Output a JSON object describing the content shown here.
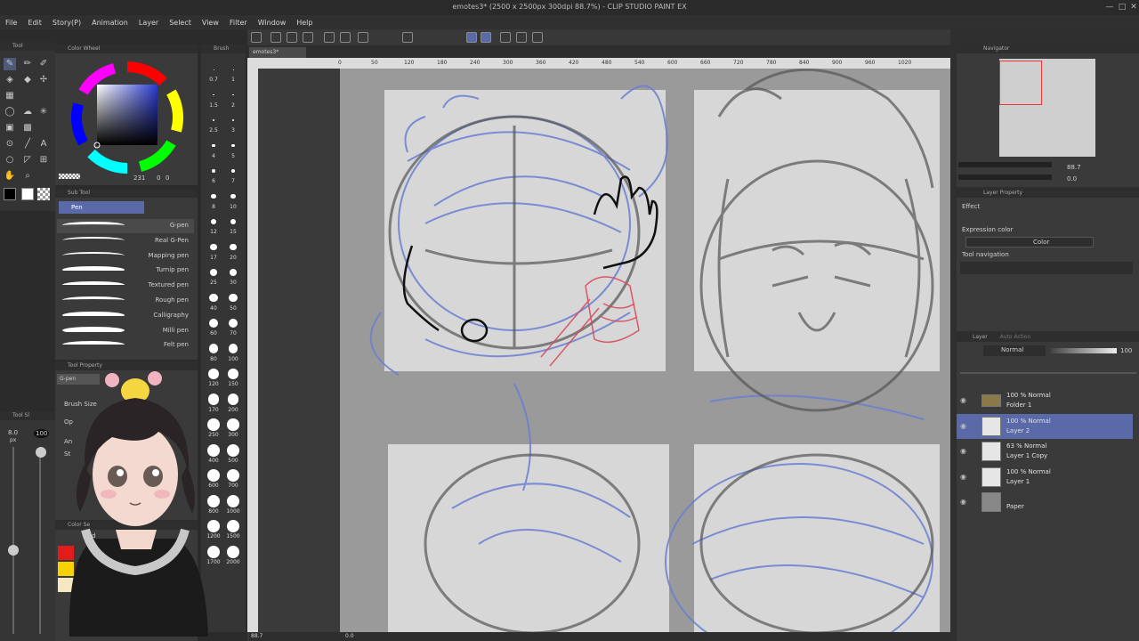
{
  "app": {
    "title": "emotes3* (2500 x 2500px 300dpi 88.7%) - CLIP STUDIO PAINT EX",
    "window_controls": [
      "minimize-icon",
      "maximize-icon",
      "close-icon"
    ]
  },
  "menu": [
    "File",
    "Edit",
    "Story(P)",
    "Animation",
    "Layer",
    "Select",
    "View",
    "Filter",
    "Window",
    "Help"
  ],
  "panels": {
    "tool": "Tool",
    "color_wheel": "Color Wheel",
    "brush": "Brush",
    "sub_tool": "Sub Tool",
    "tool_property": "Tool Property",
    "tool_sub": "Tool Sl",
    "color_set": "Color Se",
    "navigator": "Navigator",
    "layer_property": "Layer Property",
    "layer": "Layer"
  },
  "color_wheel": {
    "values": "231",
    "zero1": "0",
    "zero2": "0"
  },
  "sub_tool": {
    "group": "Pen",
    "brushes": [
      "G-pen",
      "Real G-Pen",
      "Mapping pen",
      "Turnip pen",
      "Textured pen",
      "Rough pen",
      "Calligraphy",
      "Milli pen",
      "Felt pen"
    ],
    "selected": 0
  },
  "brush_size": {
    "top_labels": [
      "0.7",
      "1",
      "1.5",
      "2",
      "2.5",
      "3",
      "4",
      "5",
      "6",
      "7",
      "8",
      "10",
      "12",
      "15",
      "17",
      "20",
      "25",
      "30",
      "40",
      "50",
      "60",
      "70",
      "80",
      "100",
      "120",
      "150",
      "170",
      "200",
      "250",
      "300",
      "400",
      "500",
      "600",
      "700",
      "800",
      "1000",
      "1200",
      "1500",
      "1700",
      "2000"
    ]
  },
  "tool_property": {
    "name": "G-pen",
    "brush_size_label": "Brush Size",
    "opacity_label": "Op",
    "stab_label": "St",
    "aa_label": "An"
  },
  "left_strip": {
    "size": "8.0",
    "unit": "px",
    "opacity": "100"
  },
  "color_set": {
    "add_label": "Add"
  },
  "canvas": {
    "tab": "emotes3*",
    "ruler_marks": [
      "0",
      "50",
      "120",
      "180",
      "240",
      "300",
      "360",
      "420",
      "480",
      "540",
      "600",
      "660",
      "720",
      "780",
      "840",
      "900",
      "960",
      "1020"
    ],
    "zoom": "88.7",
    "rotation": "0.0"
  },
  "navigator": {
    "zoom": "88.7",
    "angle": "0.0"
  },
  "layer_property": {
    "effect_label": "Effect",
    "expression_label": "Expression color",
    "expression_value": "Color",
    "tool_navigation_label": "Tool navigation"
  },
  "layer_panel": {
    "tab_active": "Layer",
    "tab_other": "Auto Action",
    "blend_mode": "Normal",
    "opacity": "100",
    "layers": [
      {
        "mode": "100 % Normal",
        "name": "Folder 1",
        "type": "folder"
      },
      {
        "mode": "100 % Normal",
        "name": "Layer 2",
        "type": "raster",
        "selected": true
      },
      {
        "mode": "63 % Normal",
        "name": "Layer 1 Copy",
        "type": "raster"
      },
      {
        "mode": "100 % Normal",
        "name": "Layer 1",
        "type": "raster"
      },
      {
        "mode": "",
        "name": "Paper",
        "type": "paper"
      }
    ]
  },
  "colors": {
    "accent_selection": "#5a6aa8",
    "sketch_blue": "#6a7fd0",
    "sketch_red": "#d84a5a",
    "ui_dark": "#2b2b2b"
  }
}
